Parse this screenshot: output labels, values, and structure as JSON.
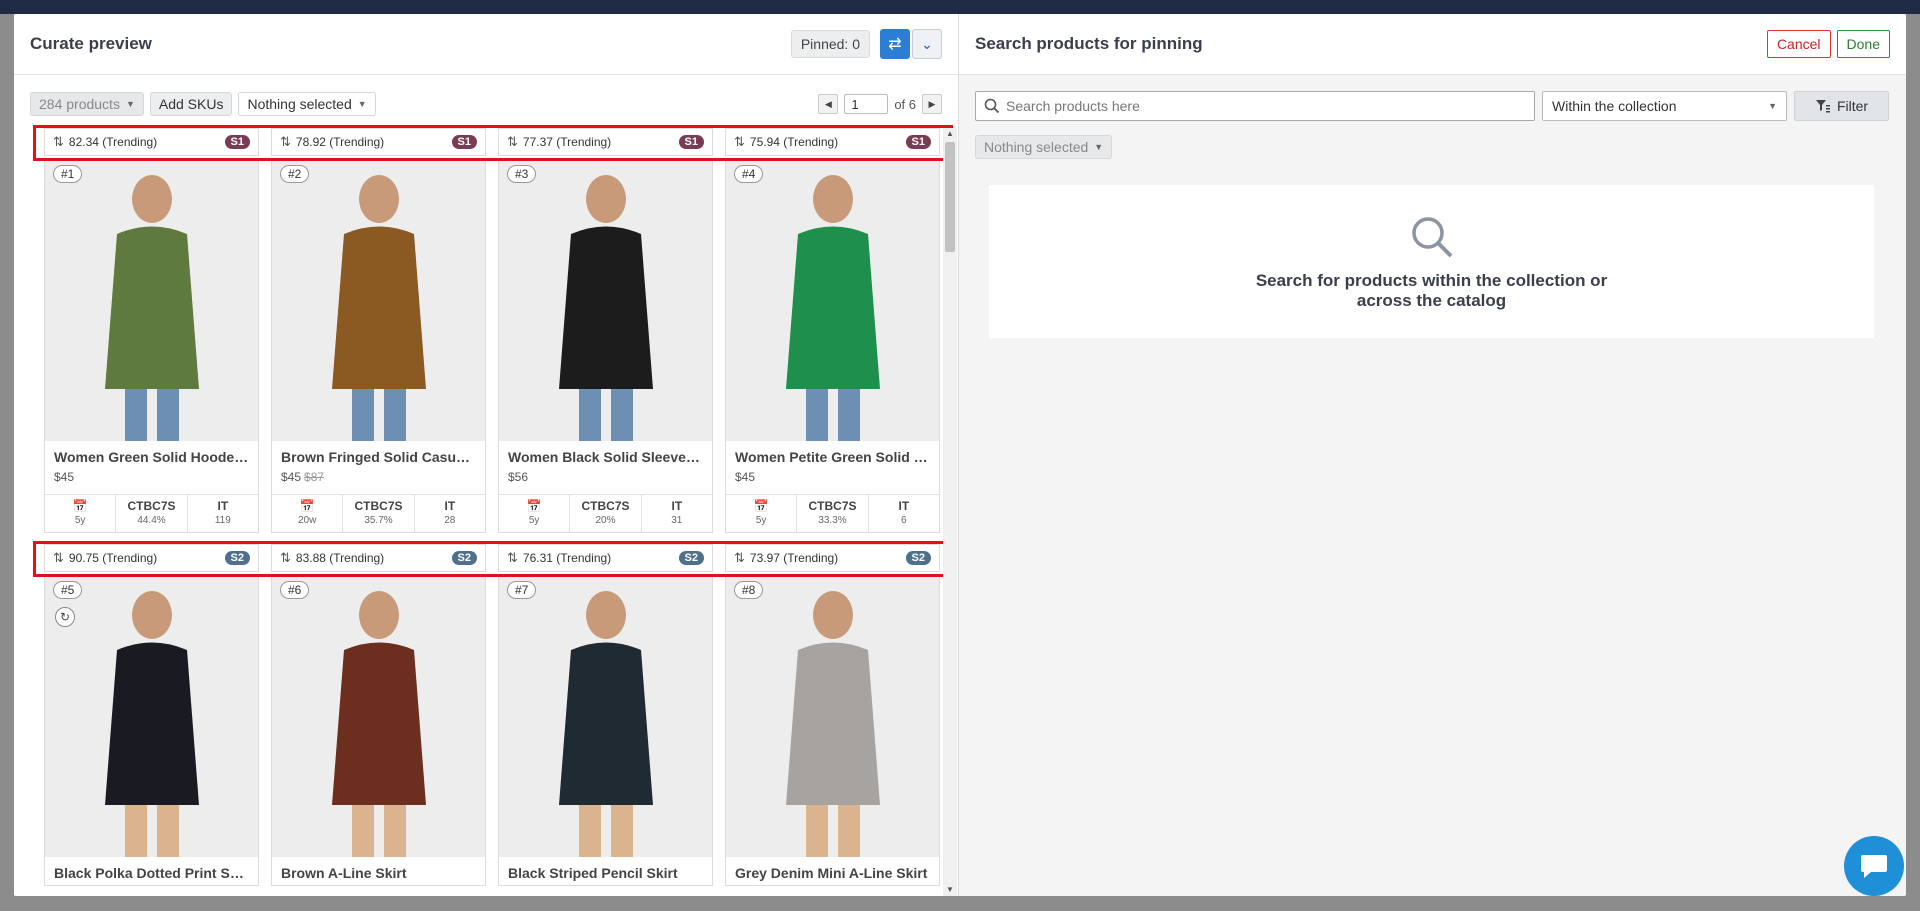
{
  "left_panel": {
    "title": "Curate preview",
    "pinned_label": "Pinned: 0",
    "toolbar": {
      "products_count": "284 products",
      "add_skus": "Add SKUs",
      "nothing_selected": "Nothing selected",
      "page_value": "1",
      "page_of": "of 6"
    },
    "rows": [
      {
        "cards": [
          {
            "score": "82.34 (Trending)",
            "segment": "S1",
            "rank": "#1",
            "name": "Women Green Solid Hooded ...",
            "price": "$45",
            "old_price": "",
            "stats": [
              {
                "k": "",
                "v": "5y"
              },
              {
                "k": "CTBC7S",
                "v": "44.4%"
              },
              {
                "k": "IT",
                "v": "119"
              }
            ],
            "color": "#5f7a3e"
          },
          {
            "score": "78.92 (Trending)",
            "segment": "S1",
            "rank": "#2",
            "name": "Brown Fringed Solid Casual S...",
            "price": "$45",
            "old_price": "$87",
            "stats": [
              {
                "k": "",
                "v": "20w"
              },
              {
                "k": "CTBC7S",
                "v": "35.7%"
              },
              {
                "k": "IT",
                "v": "28"
              }
            ],
            "color": "#8a5a22"
          },
          {
            "score": "77.37 (Trending)",
            "segment": "S1",
            "rank": "#3",
            "name": "Women Black Solid Sleeveles...",
            "price": "$56",
            "old_price": "",
            "stats": [
              {
                "k": "",
                "v": "5y"
              },
              {
                "k": "CTBC7S",
                "v": "20%"
              },
              {
                "k": "IT",
                "v": "31"
              }
            ],
            "color": "#1c1c1c"
          },
          {
            "score": "75.94 (Trending)",
            "segment": "S1",
            "rank": "#4",
            "name": "Women Petite Green Solid Top",
            "price": "$45",
            "old_price": "",
            "stats": [
              {
                "k": "",
                "v": "5y"
              },
              {
                "k": "CTBC7S",
                "v": "33.3%"
              },
              {
                "k": "IT",
                "v": "6"
              }
            ],
            "color": "#1f8f4e"
          }
        ]
      },
      {
        "cards": [
          {
            "score": "90.75 (Trending)",
            "segment": "S2",
            "rank": "#5",
            "name": "Black Polka Dotted Print Skirts",
            "price": "",
            "old_price": "",
            "stats": [],
            "color": "#1a1a22"
          },
          {
            "score": "83.88 (Trending)",
            "segment": "S2",
            "rank": "#6",
            "name": "Brown A-Line Skirt",
            "price": "",
            "old_price": "",
            "stats": [],
            "color": "#6b2e1f"
          },
          {
            "score": "76.31 (Trending)",
            "segment": "S2",
            "rank": "#7",
            "name": "Black Striped Pencil Skirt",
            "price": "",
            "old_price": "",
            "stats": [],
            "color": "#1f2a33"
          },
          {
            "score": "73.97 (Trending)",
            "segment": "S2",
            "rank": "#8",
            "name": "Grey Denim Mini A-Line Skirt",
            "price": "",
            "old_price": "",
            "stats": [],
            "color": "#a7a3a0"
          }
        ]
      }
    ]
  },
  "right_panel": {
    "title": "Search products for pinning",
    "cancel": "Cancel",
    "done": "Done",
    "search_placeholder": "Search products here",
    "scope": "Within the collection",
    "filter": "Filter",
    "nothing_selected": "Nothing selected",
    "empty_message": "Search for products within the collection or across the catalog"
  },
  "icons": {
    "swap": "swap-icon",
    "expand": "double-chevron-down-icon",
    "search": "search-icon",
    "filter": "filter-icon",
    "calendar": "calendar-icon",
    "chat": "chat-icon"
  }
}
